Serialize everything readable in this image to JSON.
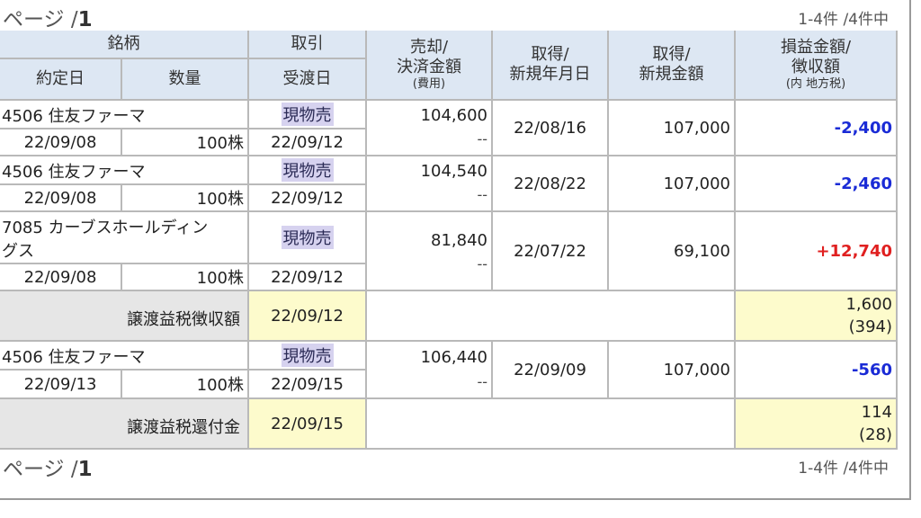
{
  "pager": {
    "page_label": "ページ /",
    "page_num": "1",
    "range": "1-4件 /4件中"
  },
  "headers": {
    "meigara": "銘柄",
    "torihiki": "取引",
    "baikyaku_1": "売却/",
    "baikyaku_2": "決済金額",
    "baikyaku_3": "(費用)",
    "shutoku_date_1": "取得/",
    "shutoku_date_2": "新規年月日",
    "shutoku_amt_1": "取得/",
    "shutoku_amt_2": "新規金額",
    "soneki_1": "損益金額/",
    "soneki_2": "徴収額",
    "soneki_3": "(内 地方税)",
    "yakujo": "約定日",
    "suryo": "数量",
    "ukewatashi": "受渡日"
  },
  "trades": [
    {
      "name": "4506 住友ファーマ",
      "type": "現物売",
      "contract_date": "22/09/08",
      "quantity": "100株",
      "settle_date": "22/09/12",
      "amount": "104,600",
      "fee": "--",
      "acq_date": "22/08/16",
      "acq_amount": "107,000",
      "pl": "-2,400"
    },
    {
      "name": "4506 住友ファーマ",
      "type": "現物売",
      "contract_date": "22/09/08",
      "quantity": "100株",
      "settle_date": "22/09/12",
      "amount": "104,540",
      "fee": "--",
      "acq_date": "22/08/22",
      "acq_amount": "107,000",
      "pl": "-2,460"
    },
    {
      "name_line1": "7085 カーブスホールディン",
      "name_line2": "グス",
      "type": "現物売",
      "contract_date": "22/09/08",
      "quantity": "100株",
      "settle_date": "22/09/12",
      "amount": "81,840",
      "fee": "--",
      "acq_date": "22/07/22",
      "acq_amount": "69,100",
      "pl": "+12,740"
    },
    {
      "name": "4506 住友ファーマ",
      "type": "現物売",
      "contract_date": "22/09/13",
      "quantity": "100株",
      "settle_date": "22/09/15",
      "amount": "106,440",
      "fee": "--",
      "acq_date": "22/09/09",
      "acq_amount": "107,000",
      "pl": "-560"
    }
  ],
  "tax_rows": [
    {
      "label": "譲渡益税徴収額",
      "date": "22/09/12",
      "amount": "1,600",
      "local": "(394)"
    },
    {
      "label": "譲渡益税還付金",
      "date": "22/09/15",
      "amount": "114",
      "local": "(28)"
    }
  ],
  "colors": {
    "header_bg": "#dde7f3",
    "negative": "#1a2bd6",
    "positive": "#e02020",
    "tax_date_bg": "#fdfbcc",
    "tax_label_bg": "#e6e6e6"
  }
}
